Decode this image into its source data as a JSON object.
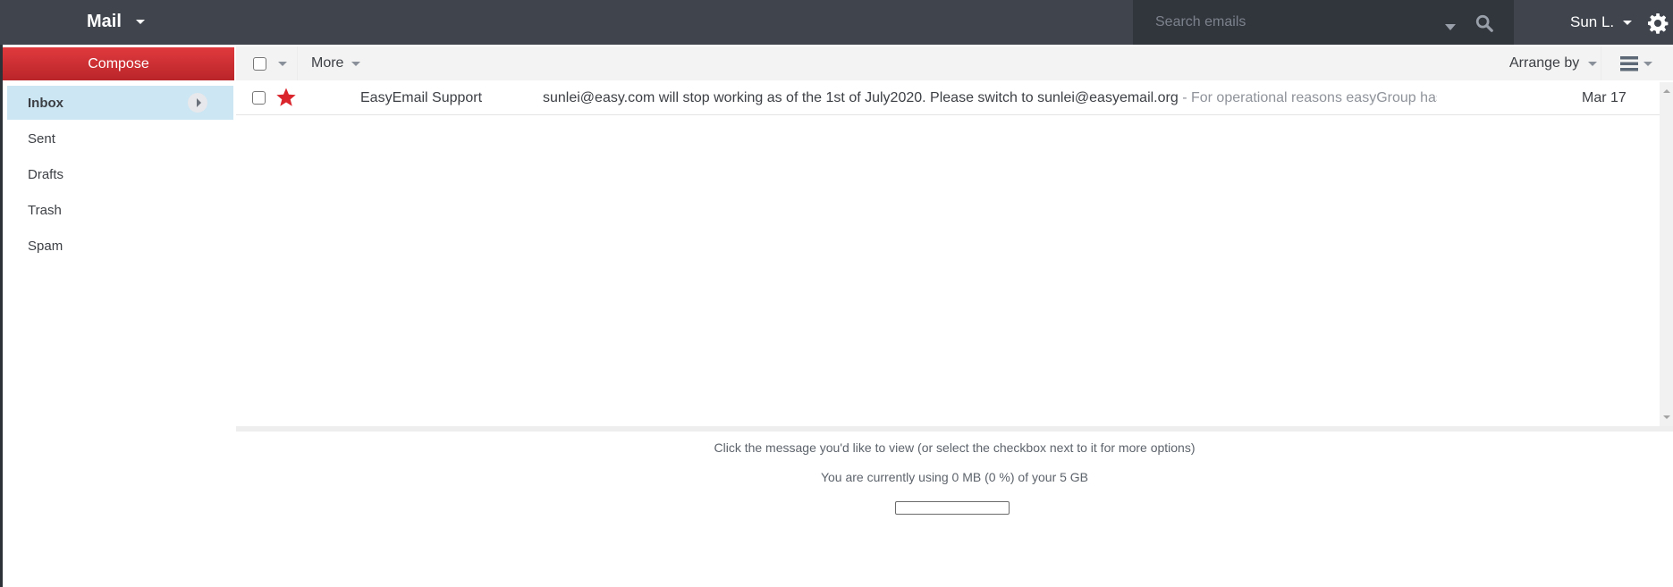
{
  "header": {
    "app_title": "Mail",
    "search": {
      "placeholder": "Search emails",
      "value": ""
    },
    "user_name": "Sun L."
  },
  "icons": {
    "app_menu": "chevron-down-icon",
    "search_options": "chevron-down-icon",
    "search": "search-icon",
    "user_menu": "chevron-down-icon",
    "settings": "gear-icon",
    "folder_expand": "chevron-right-icon",
    "star": "star-icon",
    "view_options": "list-view-icon"
  },
  "colors": {
    "header_bg": "#3f444d",
    "search_bg": "#31353c",
    "compose_bg": "#d33034",
    "active_folder_bg": "#cce6f4",
    "star": "#d9252b",
    "toolbar_bg": "#f3f3f3"
  },
  "sidebar": {
    "compose_label": "Compose",
    "folders": [
      {
        "label": "Inbox",
        "active": true
      },
      {
        "label": "Sent",
        "active": false
      },
      {
        "label": "Drafts",
        "active": false
      },
      {
        "label": "Trash",
        "active": false
      },
      {
        "label": "Spam",
        "active": false
      }
    ]
  },
  "toolbar": {
    "more_label": "More",
    "arrange_label": "Arrange by"
  },
  "messages": [
    {
      "starred": true,
      "checked": false,
      "sender": "EasyEmail Support",
      "subject": "sunlei@easy.com will stop working as of the 1st of July2020. Please switch to sunlei@easyemail.org",
      "snippet": " - For operational reasons easyGroup has decided to retain …",
      "date": "Mar 17"
    }
  ],
  "preview": {
    "hint": "Click the message you'd like to view (or select the checkbox next to it for more options)",
    "quota_text": "You are currently using 0 MB (0 %) of your 5 GB",
    "quota_percent": 0
  }
}
